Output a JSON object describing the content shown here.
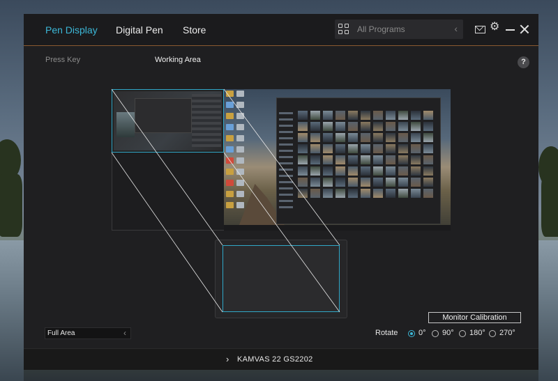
{
  "nav": {
    "tabs": [
      {
        "label": "Pen Display",
        "active": true
      },
      {
        "label": "Digital Pen",
        "active": false
      },
      {
        "label": "Store",
        "active": false
      }
    ],
    "program_selector": {
      "value": "All Programs",
      "icon": "grid-icon"
    }
  },
  "window_controls": {
    "icons": [
      "mail-icon",
      "gear-icon",
      "minimize-icon",
      "close-icon"
    ]
  },
  "subtabs": [
    {
      "label": "Press Key",
      "active": false
    },
    {
      "label": "Working Area",
      "active": true
    }
  ],
  "help": {
    "label": "?"
  },
  "area": {
    "selected": "Full Area"
  },
  "calibration": {
    "label": "Monitor Calibration"
  },
  "rotate": {
    "label": "Rotate",
    "options": [
      {
        "label": "0°",
        "selected": true
      },
      {
        "label": "90°",
        "selected": false
      },
      {
        "label": "180°",
        "selected": false
      },
      {
        "label": "270°",
        "selected": false
      }
    ]
  },
  "device": {
    "name": "KAMVAS 22 GS2202"
  },
  "colors": {
    "accent": "#3cb8d8",
    "mapping_outline": "#30a8c8",
    "background": "#1f1f21"
  }
}
